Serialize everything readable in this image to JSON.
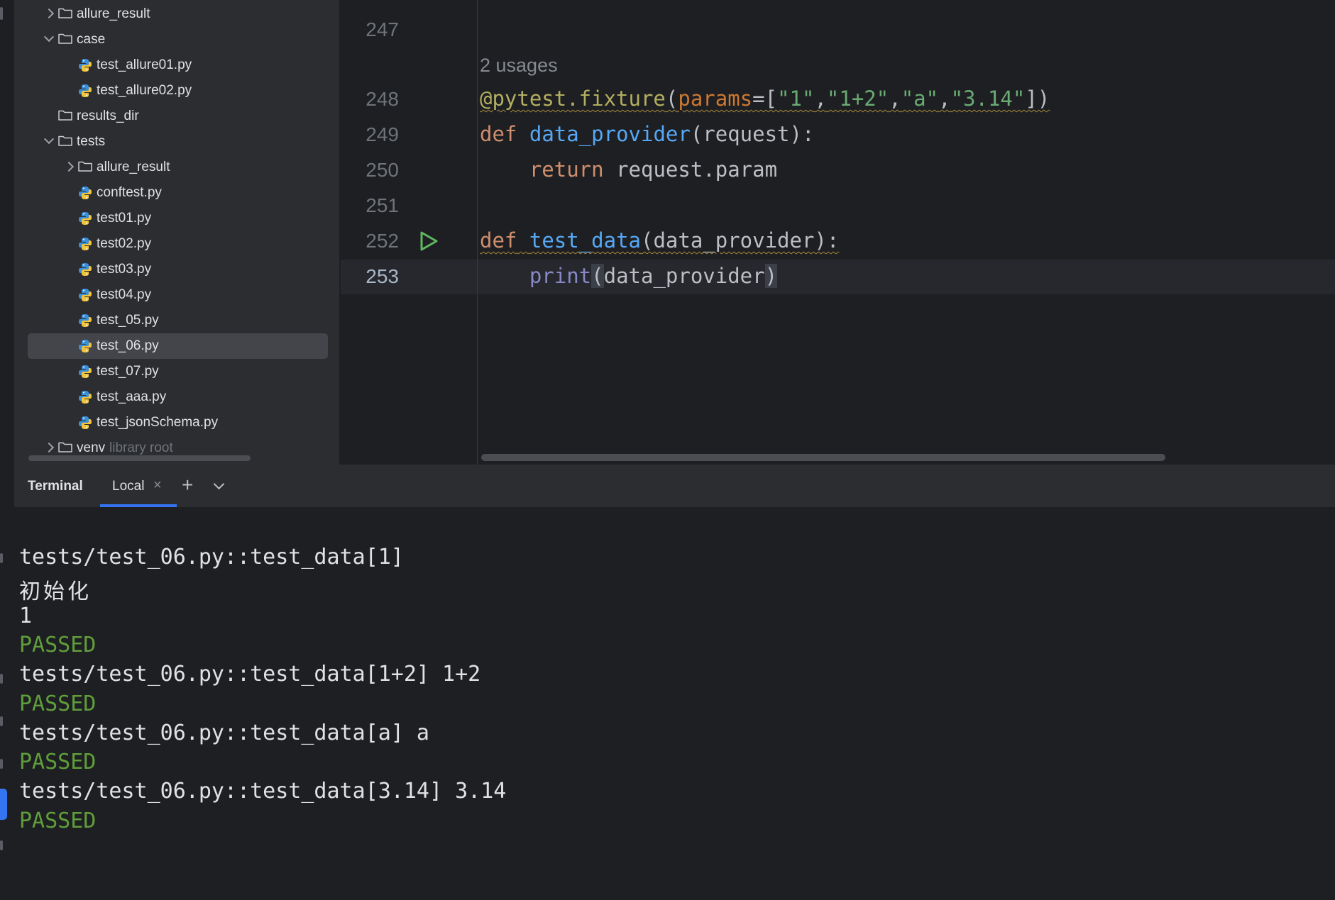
{
  "project_tree": {
    "items": [
      {
        "label": "allure_result",
        "type": "folder",
        "expander": "collapsed"
      },
      {
        "label": "case",
        "type": "folder",
        "expander": "expanded"
      },
      {
        "label": "test_allure01.py",
        "type": "python-file"
      },
      {
        "label": "test_allure02.py",
        "type": "python-file"
      },
      {
        "label": "results_dir",
        "type": "folder"
      },
      {
        "label": "tests",
        "type": "folder",
        "expander": "expanded"
      },
      {
        "label": "allure_result",
        "type": "folder",
        "expander": "collapsed"
      },
      {
        "label": "conftest.py",
        "type": "python-file"
      },
      {
        "label": "test01.py",
        "type": "python-file"
      },
      {
        "label": "test02.py",
        "type": "python-file"
      },
      {
        "label": "test03.py",
        "type": "python-file"
      },
      {
        "label": "test04.py",
        "type": "python-file"
      },
      {
        "label": "test_05.py",
        "type": "python-file"
      },
      {
        "label": "test_06.py",
        "type": "python-file",
        "selected": true
      },
      {
        "label": "test_07.py",
        "type": "python-file"
      },
      {
        "label": "test_aaa.py",
        "type": "python-file"
      },
      {
        "label": "test_jsonSchema.py",
        "type": "python-file"
      },
      {
        "label": "venv",
        "type": "folder",
        "expander": "collapsed",
        "suffix": "library root"
      }
    ]
  },
  "editor": {
    "usages_hint": "2 usages",
    "lines": [
      {
        "number": "247",
        "text": ""
      },
      {
        "number": "248",
        "text": "@pytest.fixture(params=[\"1\",\"1+2\",\"a\",\"3.14\"])"
      },
      {
        "number": "249",
        "text": "def data_provider(request):"
      },
      {
        "number": "250",
        "text": "    return request.param"
      },
      {
        "number": "251",
        "text": ""
      },
      {
        "number": "252",
        "text": "def test_data(data_provider):",
        "run_gutter": true
      },
      {
        "number": "253",
        "text": "    print(data_provider)",
        "current": true
      }
    ],
    "tokens": {
      "decorator": "@pytest.fixture",
      "paren_open": "(",
      "params_kw": "params",
      "eq_bracket": "=[",
      "s1": "\"1\"",
      "s2": "\"1+2\"",
      "s3": "\"a\"",
      "s4": "\"3.14\"",
      "comma": ",",
      "close": "])",
      "def": "def",
      "data_provider_fn": "data_provider",
      "request_sig": "(request):",
      "return": "return",
      "request_param": "request.param",
      "test_data_fn": "test_data",
      "test_data_sig": "(data_provider):",
      "print": "print",
      "lparen": "(",
      "print_arg": "data_provider",
      "rparen": ")"
    }
  },
  "terminal": {
    "title": "Terminal",
    "tab_label": "Local",
    "close_glyph": "×",
    "plus_glyph": "+",
    "output": [
      {
        "text": "tests/test_06.py::test_data[1]",
        "kind": "normal"
      },
      {
        "text": "初始化",
        "kind": "cjk"
      },
      {
        "text": "1",
        "kind": "normal"
      },
      {
        "text": "PASSED",
        "kind": "pass"
      },
      {
        "text": "tests/test_06.py::test_data[1+2] 1+2",
        "kind": "normal"
      },
      {
        "text": "PASSED",
        "kind": "pass"
      },
      {
        "text": "tests/test_06.py::test_data[a] a",
        "kind": "normal"
      },
      {
        "text": "PASSED",
        "kind": "pass"
      },
      {
        "text": "tests/test_06.py::test_data[3.14] 3.14",
        "kind": "normal"
      },
      {
        "text": "PASSED",
        "kind": "pass"
      }
    ]
  },
  "colors": {
    "accent": "#3574f0",
    "passed": "#5f9e3a",
    "keyword": "#cf8e6d",
    "function": "#56a8f5",
    "string": "#6aab73"
  }
}
